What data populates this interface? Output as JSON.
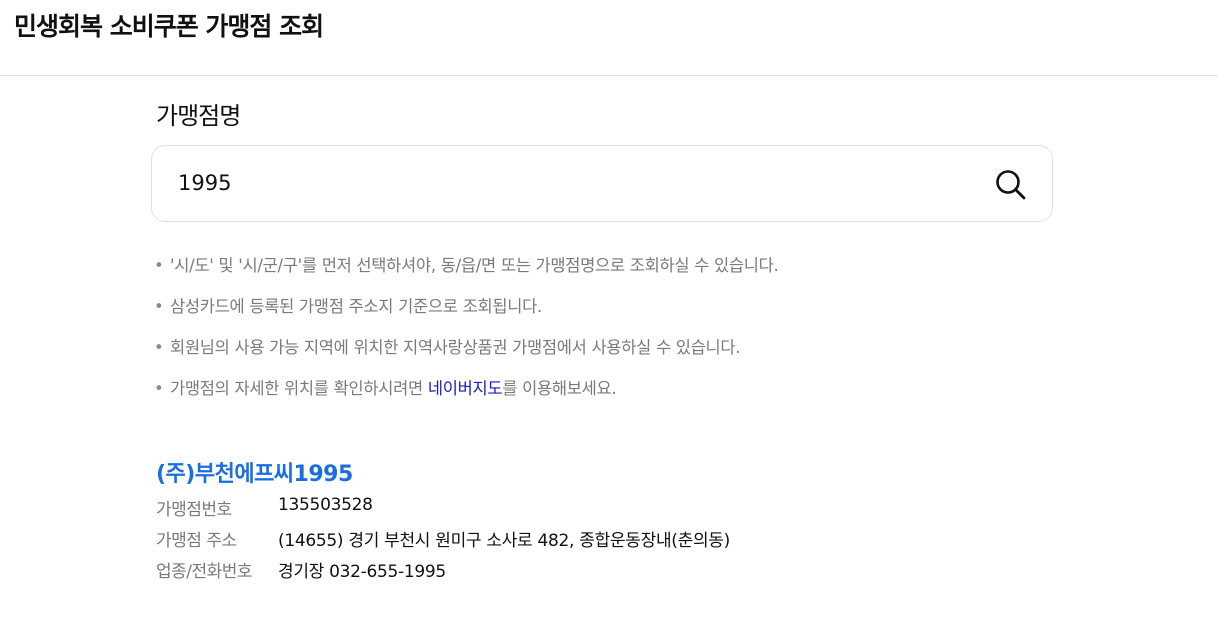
{
  "header": {
    "title": "민생회복 소비쿠폰 가맹점 조회"
  },
  "search": {
    "label": "가맹점명",
    "value": "1995"
  },
  "notes": [
    {
      "before": "'시/도' 및 '시/군/구'를 먼저 선택하셔야, 동/읍/면 또는 가맹점명으로 조회하실 수 있습니다.",
      "link": "",
      "after": ""
    },
    {
      "before": "삼성카드에 등록된 가맹점 주소지 기준으로 조회됩니다.",
      "link": "",
      "after": ""
    },
    {
      "before": "회원님의 사용 가능 지역에 위치한 지역사랑상품권 가맹점에서 사용하실 수 있습니다.",
      "link": "",
      "after": ""
    },
    {
      "before": "가맹점의 자세한 위치를 확인하시려면 ",
      "link": "네이버지도",
      "after": "를 이용해보세요."
    }
  ],
  "bullet": "•",
  "result": {
    "name": "(주)부천에프씨1995",
    "rows": [
      {
        "label": "가맹점번호",
        "value": "135503528"
      },
      {
        "label": "가맹점 주소",
        "value": "(14655) 경기 부천시 원미구 소사로 482, 종합운동장내(춘의동)"
      },
      {
        "label": "업종/전화번호",
        "value": "경기장 032-655-1995"
      }
    ]
  },
  "colors": {
    "result_name": "#1a6fe0",
    "link": "#1a1ac8",
    "muted_text": "#7a7a7a"
  },
  "icons": {
    "search": "search-icon"
  }
}
